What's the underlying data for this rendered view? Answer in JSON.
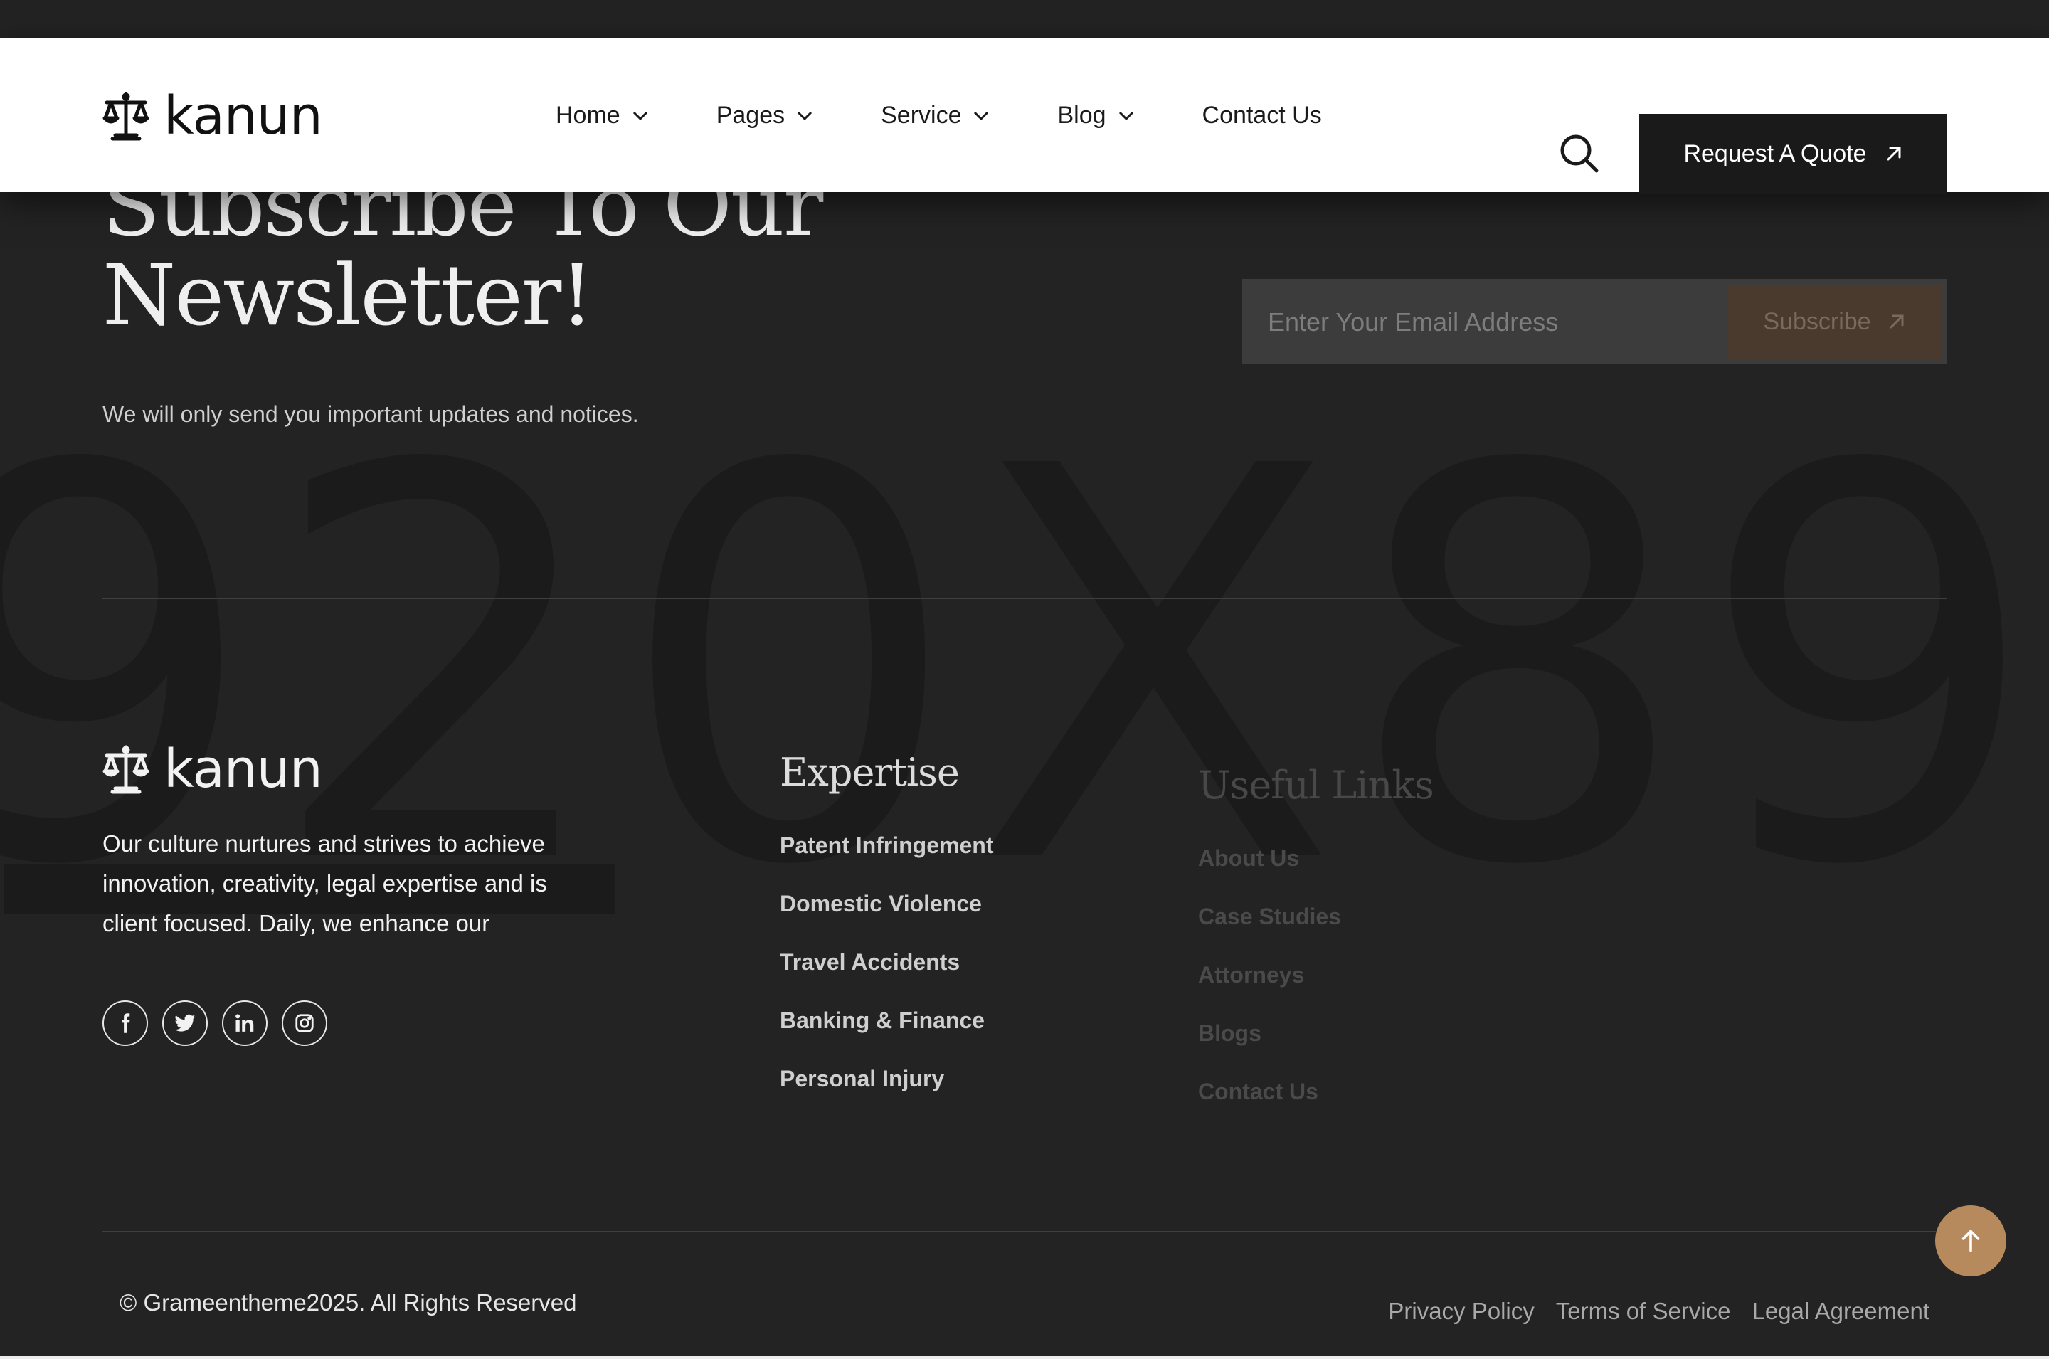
{
  "brand": {
    "name": "kanun"
  },
  "nav": {
    "items": [
      {
        "label": "Home",
        "dropdown": true
      },
      {
        "label": "Pages",
        "dropdown": true
      },
      {
        "label": "Service",
        "dropdown": true
      },
      {
        "label": "Blog",
        "dropdown": true
      },
      {
        "label": "Contact Us",
        "dropdown": false
      }
    ],
    "cta_label": "Request A Quote"
  },
  "newsletter": {
    "title_line1": "Subscribe To Our",
    "title_line2": "Newsletter!",
    "subtitle": "We will only send you important updates and notices.",
    "email_placeholder": "Enter Your Email Address",
    "subscribe_label": "Subscribe"
  },
  "watermark": "920X89",
  "footer": {
    "about": "Our culture nurtures and strives to achieve innovation, creativity, legal expertise and is client focused. Daily, we enhance our",
    "socials": [
      "facebook-icon",
      "twitter-icon",
      "linkedin-icon",
      "instagram-icon"
    ],
    "expertise": {
      "title": "Expertise",
      "links": [
        "Patent Infringement",
        "Domestic Violence",
        "Travel Accidents",
        "Banking & Finance",
        "Personal Injury"
      ]
    },
    "useful": {
      "title": "Useful Links",
      "links": [
        "About Us",
        "Case Studies",
        "Attorneys",
        "Blogs",
        "Contact Us"
      ]
    },
    "copyright": "© Grameentheme2025. All Rights Reserved",
    "legal": [
      "Privacy Policy",
      "Terms of Service",
      "Legal Agreement"
    ]
  },
  "colors": {
    "accent": "#b78a5e",
    "dark": "#232323",
    "button": "#1a1a1a"
  }
}
